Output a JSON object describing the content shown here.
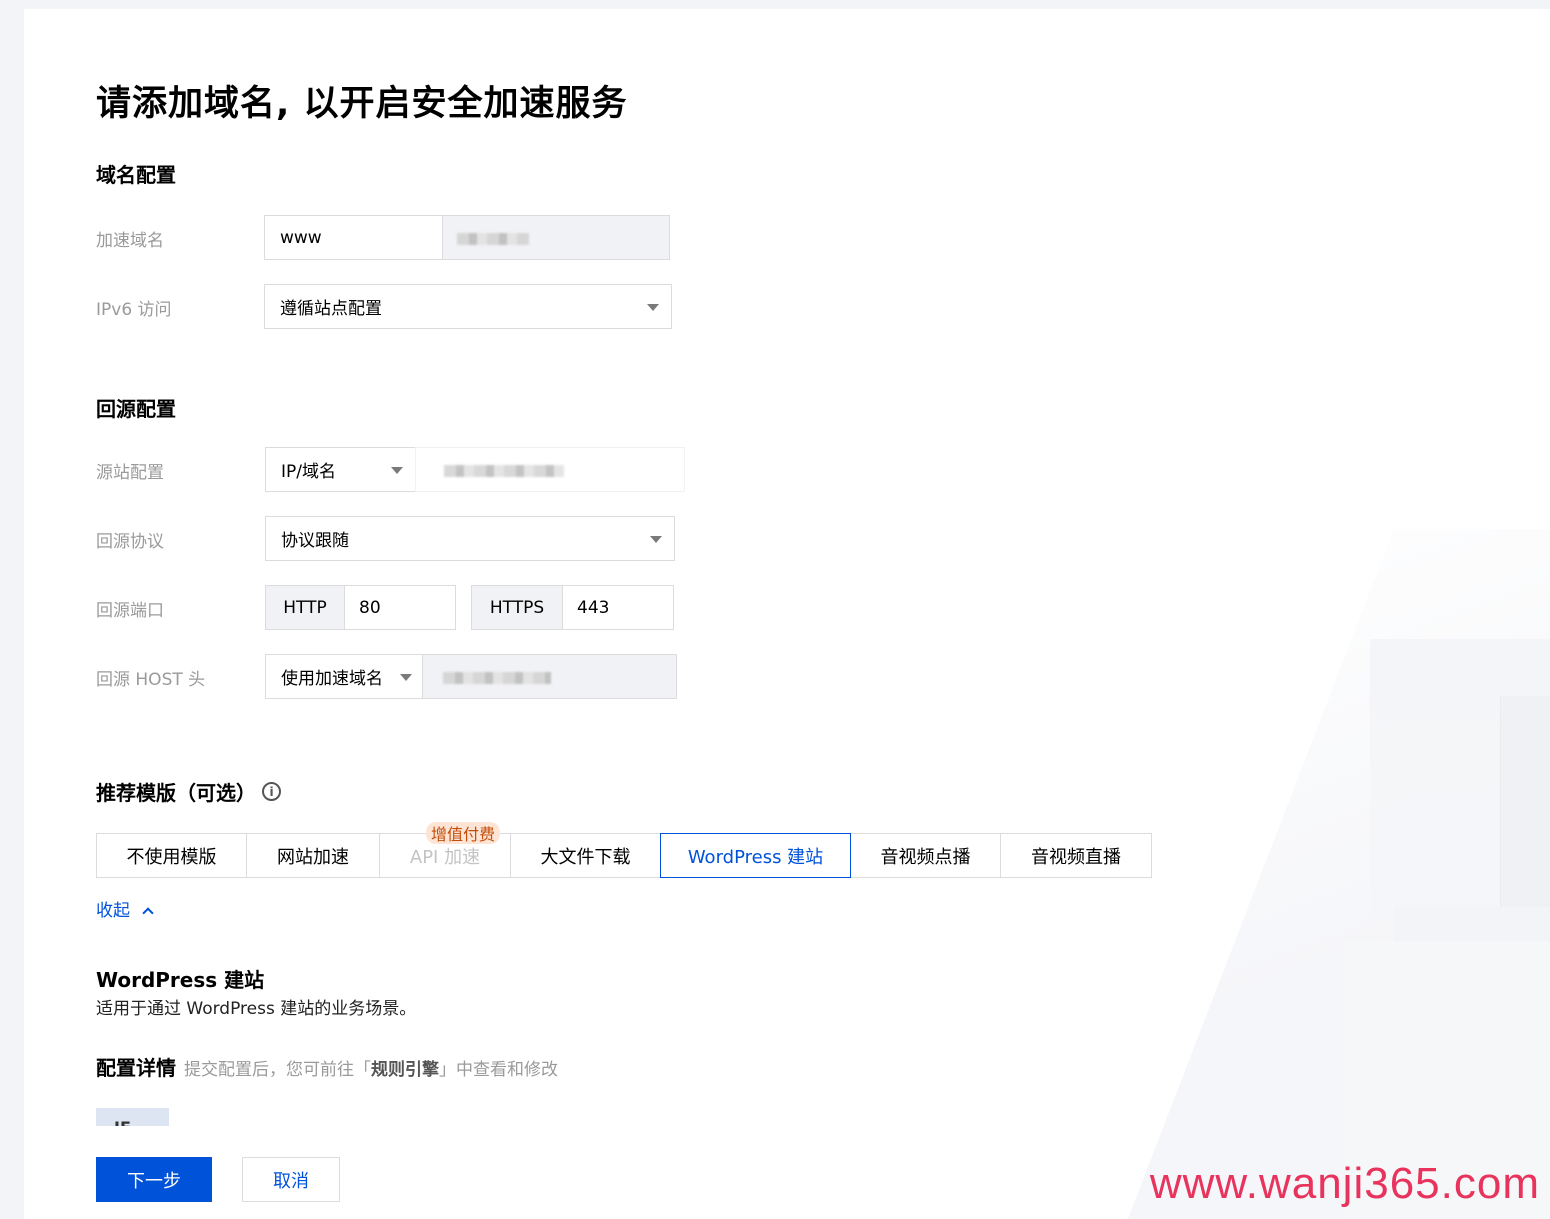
{
  "page_title": "请添加域名, 以开启安全加速服务",
  "domain_section": {
    "title": "域名配置",
    "accel_domain": {
      "label": "加速域名",
      "prefix": "www"
    },
    "ipv6": {
      "label": "IPv6 访问",
      "value": "遵循站点配置"
    }
  },
  "origin_section": {
    "title": "回源配置",
    "origin": {
      "label": "源站配置",
      "type": "IP/域名"
    },
    "protocol": {
      "label": "回源协议",
      "value": "协议跟随"
    },
    "port": {
      "label": "回源端口",
      "http_label": "HTTP",
      "http_value": "80",
      "https_label": "HTTPS",
      "https_value": "443"
    },
    "host": {
      "label": "回源 HOST 头",
      "value": "使用加速域名"
    }
  },
  "template_section": {
    "title": "推荐模版（可选）",
    "info_icon": "info-circle-icon",
    "tabs": [
      {
        "label": "不使用模版"
      },
      {
        "label": "网站加速"
      },
      {
        "label": "API 加速",
        "badge": "增值付费",
        "disabled": true
      },
      {
        "label": "大文件下载"
      },
      {
        "label": "WordPress 建站",
        "active": true
      },
      {
        "label": "音视频点播"
      },
      {
        "label": "音视频直播"
      }
    ],
    "collapse_link": "收起",
    "detail_title": "WordPress 建站",
    "detail_desc": "适用于通过 WordPress 建站的业务场景。",
    "config_title": "配置详情",
    "config_hint_prefix": "提交配置后，您可前往「",
    "config_hint_bold": "规则引擎",
    "config_hint_suffix": "」中查看和修改",
    "code_chip": "IF"
  },
  "buttons": {
    "next": "下一步",
    "cancel": "取消"
  },
  "watermark": "www.wanji365.com",
  "colors": {
    "primary": "#0052d9",
    "badge_bg": "#fde4d5",
    "badge_text": "#c34e0c",
    "watermark": "#e8335d"
  }
}
